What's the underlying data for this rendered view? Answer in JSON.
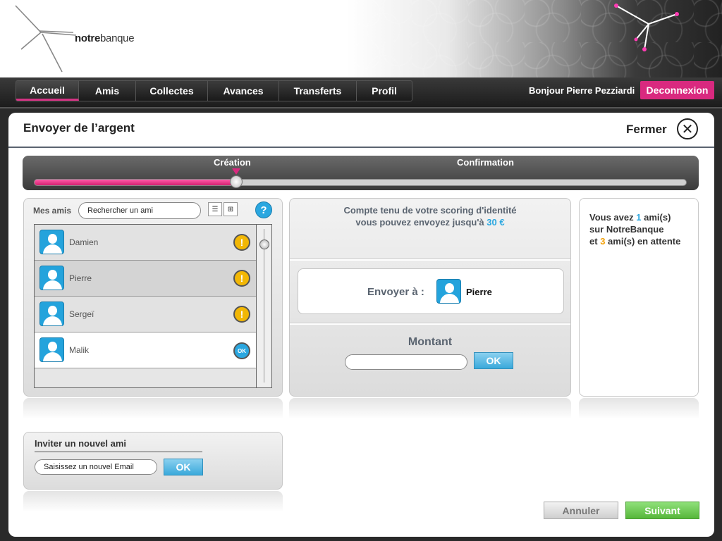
{
  "brand": {
    "logo_bold": "notre",
    "logo_rest": "banque"
  },
  "nav": {
    "tabs": [
      {
        "label": "Accueil",
        "active": true
      },
      {
        "label": "Amis"
      },
      {
        "label": "Collectes"
      },
      {
        "label": "Avances"
      },
      {
        "label": "Transferts"
      },
      {
        "label": "Profil"
      }
    ],
    "greeting": "Bonjour Pierre Pezziardi",
    "logout": "Deconnexion"
  },
  "modal": {
    "title": "Envoyer de l’argent",
    "close_label": "Fermer",
    "close_icon": "close-icon"
  },
  "stepper": {
    "steps": [
      "Création",
      "Confirmation"
    ],
    "progress": 0.31
  },
  "friends": {
    "label": "Mes amis",
    "search_value": "Rechercher un ami",
    "help": "?",
    "list_view_icon": "list-icon",
    "grid_view_icon": "grid-icon",
    "items": [
      {
        "name": "Damien",
        "status": "!"
      },
      {
        "name": "Pierre",
        "status": "!"
      },
      {
        "name": "Sergeï",
        "status": "!"
      },
      {
        "name": "Malik",
        "status": "OK"
      }
    ]
  },
  "invite": {
    "title": "Inviter un nouvel ami",
    "email_value": "Saisissez un nouvel Email",
    "ok": "OK"
  },
  "transfer": {
    "scoring_line1": "Compte tenu de votre scoring d'identité",
    "scoring_line2_prefix": "vous pouvez envoyez jusqu'à",
    "limit": "30 €",
    "send_to_label": "Envoyer à :",
    "recipient": "Pierre",
    "amount_label": "Montant",
    "amount_value": "",
    "ok": "OK"
  },
  "info": {
    "line1_prefix": "Vous avez",
    "friends_count": "1",
    "line1_suffix": "ami(s)",
    "line2": "sur NotreBanque",
    "line3_prefix": "et",
    "pending_count": "3",
    "line3_suffix": "ami(s) en attente"
  },
  "actions": {
    "cancel": "Annuler",
    "next": "Suivant"
  },
  "colors": {
    "accent_pink": "#d9297f",
    "accent_blue": "#2aa7e0",
    "next_green": "#56b73a"
  }
}
